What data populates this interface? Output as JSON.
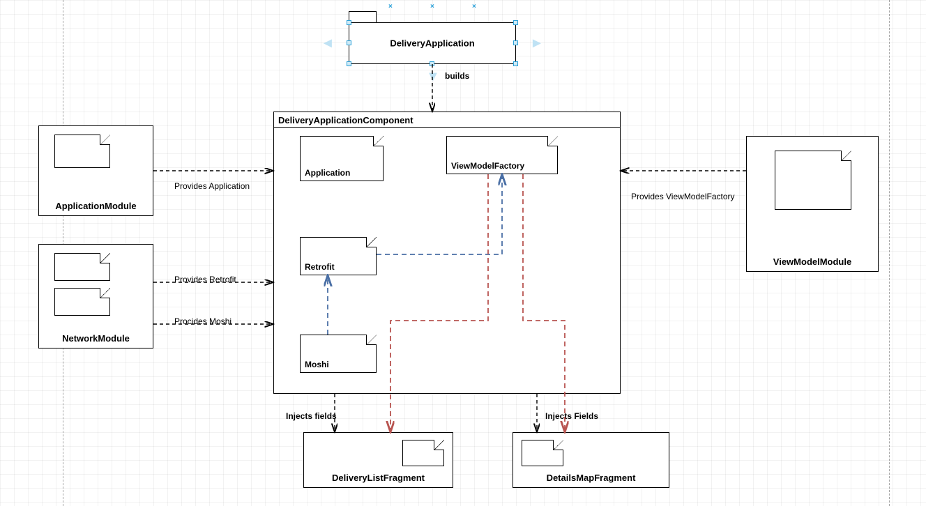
{
  "selected": {
    "name": "DeliveryApplication"
  },
  "component": {
    "title": "DeliveryApplicationComponent",
    "notes": {
      "application": "Application",
      "viewModelFactory": "ViewModelFactory",
      "retrofit": "Retrofit",
      "moshi": "Moshi"
    }
  },
  "modules": {
    "application": "ApplicationModule",
    "network": "NetworkModule",
    "viewModel": "ViewModelModule"
  },
  "fragments": {
    "list": "DeliveryListFragment",
    "map": "DetailsMapFragment"
  },
  "edges": {
    "builds": "builds",
    "providesApplication": "Provides Application",
    "providesRetrofit": "Provides Retrofit",
    "providesMoshi": "Procides Moshi",
    "providesViewModelFactory": "Provides ViewModelFactory",
    "injectsFieldsLeft": "Injects fields",
    "injectsFieldsRight": "Injects Fields"
  }
}
